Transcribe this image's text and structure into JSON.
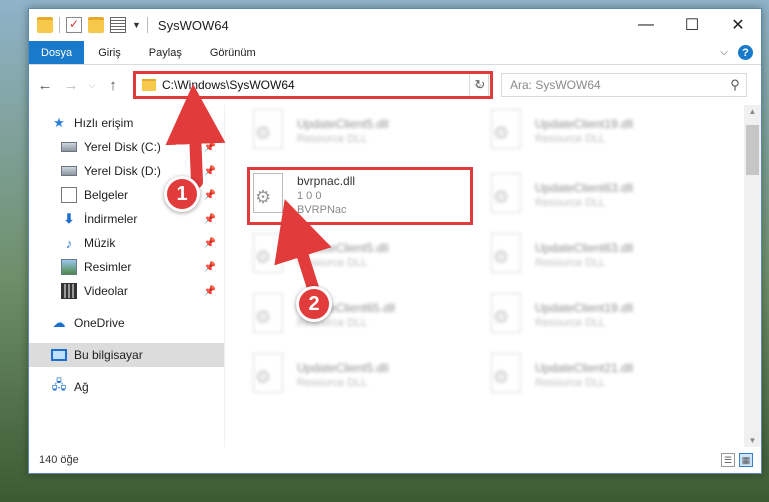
{
  "window": {
    "title": "SysWOW64",
    "controls": {
      "minimize": "—",
      "maximize": "☐",
      "close": "✕"
    }
  },
  "quick_access_toolbar": {
    "icons": [
      "folder-icon",
      "properties-check-icon",
      "new-folder-icon",
      "customize-dropdown-icon"
    ]
  },
  "ribbon": {
    "tabs": [
      {
        "label": "Dosya"
      },
      {
        "label": "Giriş"
      },
      {
        "label": "Paylaş"
      },
      {
        "label": "Görünüm"
      }
    ],
    "help": "?"
  },
  "address_bar": {
    "path": "C:\\Windows\\SysWOW64",
    "search_placeholder": "Ara: SysWOW64"
  },
  "sidebar": {
    "quick_access": "Hızlı erişim",
    "items": [
      {
        "label": "Yerel Disk (C:)",
        "icon": "drive-icon"
      },
      {
        "label": "Yerel Disk (D:)",
        "icon": "drive-icon"
      },
      {
        "label": "Belgeler",
        "icon": "documents-icon"
      },
      {
        "label": "İndirmeler",
        "icon": "downloads-icon"
      },
      {
        "label": "Müzik",
        "icon": "music-icon"
      },
      {
        "label": "Resimler",
        "icon": "pictures-icon"
      },
      {
        "label": "Videolar",
        "icon": "videos-icon"
      }
    ],
    "onedrive": "OneDrive",
    "this_pc": "Bu bilgisayar",
    "network": "Ağ"
  },
  "files": [
    {
      "name": "UpdateClient5.dll",
      "desc": "Resource DLL",
      "blurred": true
    },
    {
      "name": "UpdateClient19.dll",
      "desc": "Resource DLL",
      "blurred": true
    },
    {
      "name": "bvrpnac.dll",
      "version": "1 0 0",
      "desc": "BVRPNac",
      "blurred": false
    },
    {
      "name": "UpdateClient63.dll",
      "desc": "Resource DLL",
      "blurred": true
    },
    {
      "name": "UpdateClient5.dll",
      "desc": "Resource DLL",
      "blurred": true
    },
    {
      "name": "UpdateClient63.dll",
      "desc": "Resource DLL",
      "blurred": true
    },
    {
      "name": "UpdateClient65.dll",
      "desc": "Resource DLL",
      "blurred": true
    },
    {
      "name": "UpdateClient19.dll",
      "desc": "Resource DLL",
      "blurred": true
    },
    {
      "name": "UpdateClient5.dll",
      "desc": "Resource DLL",
      "blurred": true
    },
    {
      "name": "UpdateClient21.dll",
      "desc": "Resource DLL",
      "blurred": true
    }
  ],
  "status_bar": {
    "item_count": "140 öğe"
  },
  "callouts": [
    {
      "number": "1"
    },
    {
      "number": "2"
    }
  ],
  "colors": {
    "accent": "#1979ca",
    "callout": "#e23b3b",
    "highlight_box": "#e03a3a"
  }
}
